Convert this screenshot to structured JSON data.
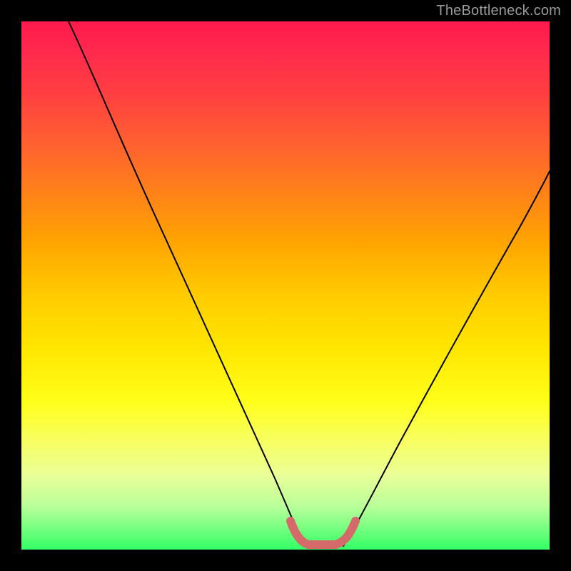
{
  "watermark": "TheBottleneck.com",
  "chart_data": {
    "type": "line",
    "title": "",
    "xlabel": "",
    "ylabel": "",
    "xlim": [
      0,
      100
    ],
    "ylim": [
      0,
      100
    ],
    "legend": false,
    "grid": false,
    "background_gradient_stops": [
      {
        "pos": 0,
        "color": "#ff1a4d"
      },
      {
        "pos": 14,
        "color": "#ff4040"
      },
      {
        "pos": 32,
        "color": "#ff801a"
      },
      {
        "pos": 52,
        "color": "#ffcc00"
      },
      {
        "pos": 72,
        "color": "#ffff1a"
      },
      {
        "pos": 100,
        "color": "#33ff66"
      }
    ],
    "series": [
      {
        "name": "black-curve-left",
        "color": "#000000",
        "x": [
          9,
          15,
          22,
          30,
          38,
          45,
          50,
          52.5
        ],
        "y": [
          100,
          86,
          70,
          52,
          34,
          18,
          6,
          0
        ]
      },
      {
        "name": "black-curve-right",
        "color": "#000000",
        "x": [
          61,
          66,
          74,
          82,
          90,
          100
        ],
        "y": [
          0,
          10,
          26,
          42,
          58,
          76
        ]
      },
      {
        "name": "salmon-valley-band",
        "color": "#d46a6a",
        "x": [
          50.5,
          52,
          55,
          58,
          60,
          61.5
        ],
        "y": [
          5,
          1.5,
          0.5,
          0.5,
          1.5,
          5
        ]
      }
    ],
    "annotations": []
  }
}
